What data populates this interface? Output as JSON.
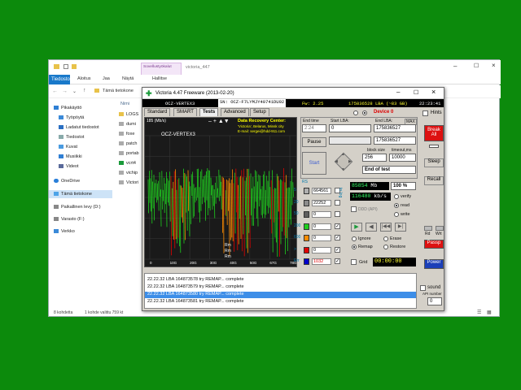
{
  "explorer": {
    "ribbon_context_group": "Sovellustyökalut",
    "window_title": "victoria_447",
    "tabs": [
      "Tiedosto",
      "Aloitus",
      "Jaa",
      "Näytä",
      "Hallitse"
    ],
    "address_path": "Tämä tietokone",
    "column_name": "Nimi",
    "nav": [
      {
        "label": "Pikakäyttö",
        "icon": "star-icon"
      },
      {
        "label": "Työpöytä",
        "icon": "folder-icon"
      },
      {
        "label": "Ladatut tiedostot",
        "icon": "download-icon"
      },
      {
        "label": "Tiedostot",
        "icon": "folder-icon"
      },
      {
        "label": "Kuvat",
        "icon": "pictures-icon"
      },
      {
        "label": "Musiikki",
        "icon": "music-icon"
      },
      {
        "label": "Videot",
        "icon": "video-icon"
      },
      {
        "label": "OneDrive",
        "icon": "cloud-icon"
      },
      {
        "label": "Tämä tietokone",
        "icon": "computer-icon"
      },
      {
        "label": "Paikallinen levy (D:)",
        "icon": "drive-icon"
      },
      {
        "label": "Varasto (F:)",
        "icon": "drive-icon"
      },
      {
        "label": "Verkko",
        "icon": "network-icon"
      }
    ],
    "files": [
      "LOGS",
      "dumi",
      "foxe",
      "patch",
      "portab",
      "vcrt4",
      "vichip",
      "Victori"
    ],
    "status_left": "8 kohdetta",
    "status_right": "1 kohde valittu  759 kt"
  },
  "victoria": {
    "title": "Victoria 4.47  Freeware (2013-02-20)",
    "tabs": [
      "Standard",
      "SMART",
      "Tests",
      "Advanced",
      "Setup"
    ],
    "active_tab": "Tests",
    "drive_model": "OCZ-VERTEX3",
    "serial": "SN: OCZ-F7LYMJY40741DU92",
    "firmware": "Fw: 2.25",
    "capacity": "175836528 LBA (~83 GB)",
    "clock": "22:23:41",
    "graph": {
      "unit_label": "185 (Mb/s)",
      "model_label": "OCZ-VERTEX3",
      "ad_title": "Data Recovery Center:",
      "ad_line1": "'Victoria', Belarus, Minsk city",
      "ad_line2": "E-mail: sergei@hdd-911.com",
      "x_ticks": [
        "0",
        "10G",
        "20G",
        "30G",
        "40G",
        "50G",
        "67G",
        "78G"
      ],
      "overlay_labels": [
        "Rm",
        "Rm",
        "Rm"
      ]
    },
    "end_time_label": "End time",
    "end_time_value": "2:24",
    "start_lba_label": "Start LBA:",
    "start_lba_value": "0",
    "end_lba_label": "End LBA:",
    "end_lba_max": "MAX",
    "end_lba_value": "175836527",
    "current_lba_value": "175836527",
    "pause_label": "Pause",
    "start_label": "Start",
    "block_size_label": "block size",
    "block_size_value": "256",
    "timeout_label": "timeout,ms",
    "timeout_value": "10000",
    "end_of_test": "End of test",
    "device_label": "Device 0",
    "hints_label": "Hints",
    "rs_label": "RS",
    "rs_value": "85854",
    "rs_unit": "Mb",
    "percent": "100",
    "percent_unit": "%",
    "speed_value": "116480",
    "speed_unit": "kb/s",
    "ddd_label": "DDD (API)",
    "verify_label": "verify",
    "read_label": "read",
    "write_label": "write",
    "selected_mode": "read",
    "ignore_label": "Ignore",
    "remap_label": "Remap",
    "erase_label": "Erase",
    "restore_label": "Restore",
    "selected_action": "Remap",
    "grid_label": "Grid",
    "timer": "00:00:00",
    "legend": [
      {
        "label": "5",
        "value": "664561",
        "color": "#b0b0b0"
      },
      {
        "label": "20",
        "value": "22252",
        "color": "#8c8c8c"
      },
      {
        "label": "50",
        "value": "0",
        "color": "#5f5f5f"
      },
      {
        "label": "200",
        "value": "0",
        "color": "#1fcf1f"
      },
      {
        "label": "600",
        "value": "0",
        "color": "#ff8c00"
      },
      {
        "label": ">",
        "value": "0",
        "color": "#e00000"
      },
      {
        "label": "Err",
        "value": "1032",
        "color": "#0000cc"
      }
    ],
    "break_label": "Break All",
    "sleep_label": "Sleep",
    "recall_label": "Recall",
    "passp_label": "Passp",
    "power_label": "Power",
    "rd_label": "Rd",
    "wrt_label": "Wrt",
    "sound_label": "sound",
    "api_number_label": "API number",
    "api_number_value": "0",
    "log": [
      "22.22.32   LBA 164873578 try REMAP... complete",
      "22.22.32   LBA 164873579 try REMAP... complete",
      "22.22.32   LBA 164873580 try REMAP... complete",
      "22.22.32   LBA 164873581 try REMAP... complete"
    ],
    "log_selected_index": 2,
    "colors": {
      "green": "#1fcf1f",
      "orange": "#ff8c00",
      "red": "#e00000",
      "break": "#d11",
      "power": "#1b3fb8"
    }
  }
}
